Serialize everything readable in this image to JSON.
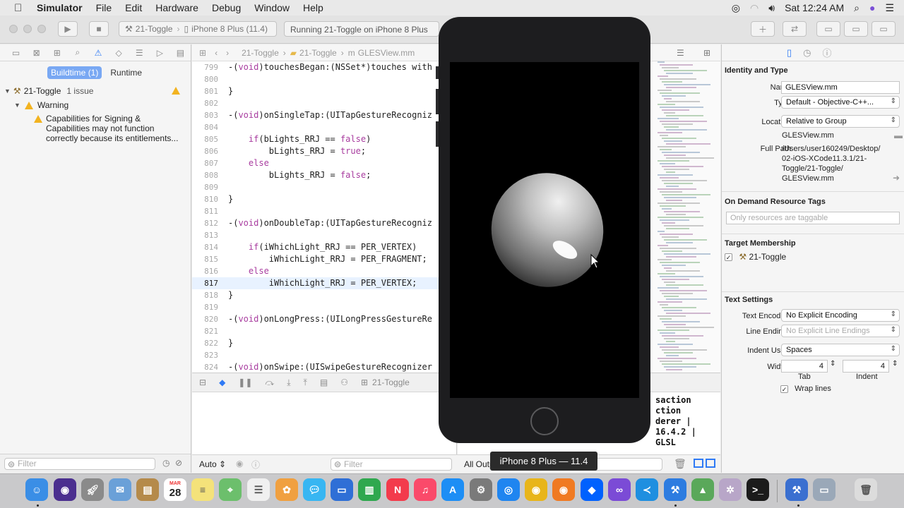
{
  "menubar": {
    "app": "Simulator",
    "items": [
      "File",
      "Edit",
      "Hardware",
      "Debug",
      "Window",
      "Help"
    ],
    "clock": "Sat 12:24 AM"
  },
  "toolbar": {
    "scheme": "21-Toggle",
    "device": "iPhone 8 Plus (11.4)",
    "status": "Running 21-Toggle on iPhone 8 Plus"
  },
  "navigator": {
    "tabs": [
      "Buildtime (1)",
      "Runtime"
    ],
    "project": "21-Toggle",
    "project_issues": "1 issue",
    "group": "Warning",
    "warning_lines": [
      "Capabilities for Signing &",
      "Capabilities may not function",
      "correctly because its entitlements..."
    ],
    "filter_placeholder": "Filter"
  },
  "jumpbar": {
    "crumbs": [
      "21-Toggle",
      "21-Toggle",
      "GLESView.mm"
    ]
  },
  "code_lines": [
    {
      "n": "799",
      "t": "-(void)touchesBegan:(NSSet*)touches with"
    },
    {
      "n": "800",
      "t": ""
    },
    {
      "n": "801",
      "t": "}"
    },
    {
      "n": "802",
      "t": ""
    },
    {
      "n": "803",
      "t": "-(void)onSingleTap:(UITapGestureRecogniz"
    },
    {
      "n": "804",
      "t": ""
    },
    {
      "n": "805",
      "t": "    if(bLights_RRJ == false)"
    },
    {
      "n": "806",
      "t": "        bLights_RRJ = true;"
    },
    {
      "n": "807",
      "t": "    else"
    },
    {
      "n": "808",
      "t": "        bLights_RRJ = false;"
    },
    {
      "n": "809",
      "t": ""
    },
    {
      "n": "810",
      "t": "}"
    },
    {
      "n": "811",
      "t": ""
    },
    {
      "n": "812",
      "t": "-(void)onDoubleTap:(UITapGestureRecogniz"
    },
    {
      "n": "813",
      "t": ""
    },
    {
      "n": "814",
      "t": "    if(iWhichLight_RRJ == PER_VERTEX)"
    },
    {
      "n": "815",
      "t": "        iWhichLight_RRJ = PER_FRAGMENT;"
    },
    {
      "n": "816",
      "t": "    else"
    },
    {
      "n": "817",
      "t": "        iWhichLight_RRJ = PER_VERTEX;"
    },
    {
      "n": "818",
      "t": "}"
    },
    {
      "n": "819",
      "t": ""
    },
    {
      "n": "820",
      "t": "-(void)onLongPress:(UILongPressGestureRe"
    },
    {
      "n": "821",
      "t": ""
    },
    {
      "n": "822",
      "t": "}"
    },
    {
      "n": "823",
      "t": ""
    },
    {
      "n": "824",
      "t": "-(void)onSwipe:(UISwipeGestureRecognizer"
    }
  ],
  "debug": {
    "target": "21-Toggle",
    "auto": "Auto",
    "output": "All Output",
    "filter_placeholder": "Filter",
    "console_lines": [
      "saction",
      "ction",
      "derer |",
      "16.4.2 | GLSL"
    ]
  },
  "inspector": {
    "identity_title": "Identity and Type",
    "name_label": "Name",
    "name_value": "GLESView.mm",
    "type_label": "Type",
    "type_value": "Default - Objective-C++...",
    "location_label": "Location",
    "location_value": "Relative to Group",
    "location_file": "GLESView.mm",
    "full_path_label": "Full Path",
    "full_path_lines": [
      "/Users/user160249/Desktop/",
      "02-iOS-XCode11.3.1/21-",
      "Toggle/21-Toggle/",
      "GLESView.mm"
    ],
    "on_demand_title": "On Demand Resource Tags",
    "tags_placeholder": "Only resources are taggable",
    "target_title": "Target Membership",
    "target_name": "21-Toggle",
    "text_settings_title": "Text Settings",
    "encoding_label": "Text Encoding",
    "encoding_value": "No Explicit Encoding",
    "line_endings_label": "Line Endings",
    "line_endings_value": "No Explicit Line Endings",
    "indent_using_label": "Indent Using",
    "indent_using_value": "Spaces",
    "widths_label": "Widths",
    "tab_value": "4",
    "indent_value": "4",
    "tab_caption": "Tab",
    "indent_caption": "Indent",
    "wrap_lines": "Wrap lines"
  },
  "simulator": {
    "label": "iPhone 8 Plus — 11.4"
  },
  "dock": {
    "calendar_month": "MAR",
    "calendar_day": "28"
  }
}
